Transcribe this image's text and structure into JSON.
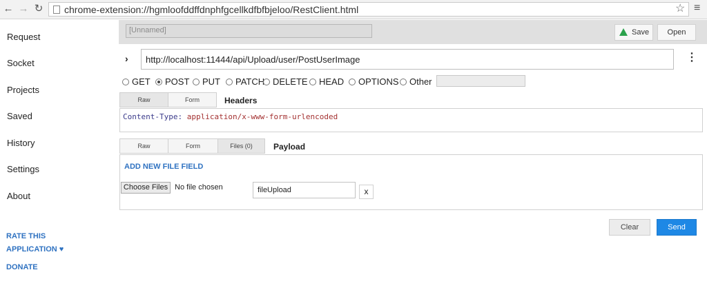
{
  "browser": {
    "url": "chrome-extension://hgmloofddffdnphfgcellkdfbfbjeloo/RestClient.html",
    "icons": [
      "back-arrow-icon",
      "forward-arrow-icon",
      "reload-icon",
      "star-icon",
      "chrome-menu-icon"
    ]
  },
  "sidebar": {
    "items": [
      "Request",
      "Socket",
      "Projects",
      "Saved",
      "History",
      "Settings",
      "About"
    ],
    "rate_line1": "RATE THIS",
    "rate_line2": "APPLICATION ♥",
    "donate": "DONATE"
  },
  "request": {
    "name_placeholder": "[Unnamed]",
    "save_label": "Save",
    "open_label": "Open",
    "url": "http://localhost:11444/api/Upload/user/PostUserImage",
    "methods": [
      "GET",
      "POST",
      "PUT",
      "PATCH",
      "DELETE",
      "HEAD",
      "OPTIONS",
      "Other"
    ],
    "selected_method": "POST"
  },
  "headers": {
    "tabs": [
      "Raw",
      "Form"
    ],
    "active_tab": "Raw",
    "title": "Headers",
    "key": "Content-Type:",
    "value": "application/x-www-form-urlencoded"
  },
  "payload": {
    "tabs": [
      "Raw",
      "Form",
      "Files (0)"
    ],
    "active_tab": "Files (0)",
    "title": "Payload",
    "add_file": "ADD NEW FILE FIELD",
    "choose_files": "Choose Files",
    "no_file": "No file chosen",
    "field_name": "fileUpload",
    "remove": "x"
  },
  "actions": {
    "clear": "Clear",
    "send": "Send"
  },
  "colors": {
    "link": "#2f72c1",
    "send": "#1e88e5"
  }
}
